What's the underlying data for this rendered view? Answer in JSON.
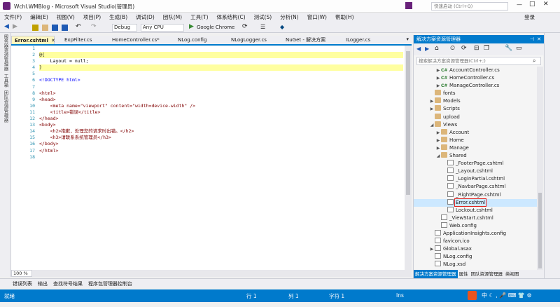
{
  "window": {
    "title": "Wchl.WMBlog - Microsoft Visual Studio(管理员)",
    "quick_launch_placeholder": "快速启动 (Ctrl+Q)",
    "login_label": "登录"
  },
  "menu": [
    "文件(F)",
    "编辑(E)",
    "视图(V)",
    "项目(P)",
    "生成(B)",
    "调试(D)",
    "团队(M)",
    "工具(T)",
    "体系结构(C)",
    "测试(S)",
    "分析(N)",
    "窗口(W)",
    "帮助(H)"
  ],
  "toolbar": {
    "config": "Debug",
    "platform": "Any CPU",
    "run_target": "Google Chrome"
  },
  "left_sidebar": [
    "服务器资源管理器",
    "工具箱",
    "团队资源管理器"
  ],
  "tabs": [
    {
      "label": "Error.cshtml",
      "active": true
    },
    {
      "label": "ExpFilter.cs",
      "active": false
    },
    {
      "label": "HomeController.cs*",
      "active": false
    },
    {
      "label": "NLog.config",
      "active": false
    },
    {
      "label": "NLogLogger.cs",
      "active": false
    },
    {
      "label": "NuGet - 解决方案",
      "active": false
    },
    {
      "label": "ILogger.cs",
      "active": false
    }
  ],
  "code_lines": [
    "",
    "@{",
    "    Layout = null;",
    "}",
    "",
    "<!DOCTYPE html>",
    "",
    "<html>",
    "<head>",
    "    <meta name=\"viewport\" content=\"width=device-width\" />",
    "    <title>错误</title>",
    "</head>",
    "<body>",
    "    <h2>抱歉，处理您的请求时出错。</h2>",
    "    <h3>请联系系统管理员</h3>",
    "</body>",
    "</html>",
    ""
  ],
  "zoom": "100 %",
  "bottom_tabs": [
    "错误列表",
    "输出",
    "查找符号结果",
    "程序包管理器控制台"
  ],
  "status": {
    "left": "就绪",
    "line": "行 1",
    "col": "列 1",
    "char": "字符 1",
    "ins": "Ins"
  },
  "solution_explorer": {
    "title": "解决方案资源管理器",
    "search_placeholder": "搜索解决方案资源管理器(Ctrl+;)",
    "tree": [
      {
        "label": "AccountController.cs",
        "indent": 3,
        "type": "cs",
        "arrow": "▶"
      },
      {
        "label": "HomeController.cs",
        "indent": 3,
        "type": "cs",
        "arrow": "▶"
      },
      {
        "label": "ManageController.cs",
        "indent": 3,
        "type": "cs",
        "arrow": "▶"
      },
      {
        "label": "fonts",
        "indent": 2,
        "type": "folder",
        "arrow": ""
      },
      {
        "label": "Models",
        "indent": 2,
        "type": "folder",
        "arrow": "▶"
      },
      {
        "label": "Scripts",
        "indent": 2,
        "type": "folder",
        "arrow": "▶"
      },
      {
        "label": "upload",
        "indent": 2,
        "type": "folder",
        "arrow": ""
      },
      {
        "label": "Views",
        "indent": 2,
        "type": "folder",
        "arrow": "◢"
      },
      {
        "label": "Account",
        "indent": 3,
        "type": "folder",
        "arrow": "▶"
      },
      {
        "label": "Home",
        "indent": 3,
        "type": "folder",
        "arrow": "▶"
      },
      {
        "label": "Manage",
        "indent": 3,
        "type": "folder",
        "arrow": "▶"
      },
      {
        "label": "Shared",
        "indent": 3,
        "type": "folder",
        "arrow": "◢"
      },
      {
        "label": "_FooterPage.cshtml",
        "indent": 4,
        "type": "file",
        "arrow": ""
      },
      {
        "label": "_Layout.cshtml",
        "indent": 4,
        "type": "file",
        "arrow": ""
      },
      {
        "label": "_LoginPartial.cshtml",
        "indent": 4,
        "type": "file",
        "arrow": ""
      },
      {
        "label": "_NavbarPage.cshtml",
        "indent": 4,
        "type": "file",
        "arrow": ""
      },
      {
        "label": "_RightPage.cshtml",
        "indent": 4,
        "type": "file",
        "arrow": ""
      },
      {
        "label": "Error.cshtml",
        "indent": 4,
        "type": "file",
        "arrow": "",
        "selected": true
      },
      {
        "label": "Lockout.cshtml",
        "indent": 4,
        "type": "file",
        "arrow": ""
      },
      {
        "label": "_ViewStart.cshtml",
        "indent": 3,
        "type": "file",
        "arrow": ""
      },
      {
        "label": "Web.config",
        "indent": 3,
        "type": "file",
        "arrow": ""
      },
      {
        "label": "ApplicationInsights.config",
        "indent": 2,
        "type": "file",
        "arrow": ""
      },
      {
        "label": "favicon.ico",
        "indent": 2,
        "type": "file",
        "arrow": ""
      },
      {
        "label": "Global.asax",
        "indent": 2,
        "type": "file",
        "arrow": "▶"
      },
      {
        "label": "NLog.config",
        "indent": 2,
        "type": "file",
        "arrow": ""
      },
      {
        "label": "NLog.xsd",
        "indent": 2,
        "type": "file",
        "arrow": ""
      }
    ],
    "bottom_tabs": [
      "解决方案资源管理器",
      "属性",
      "团队资源管理器",
      "类视图"
    ]
  }
}
